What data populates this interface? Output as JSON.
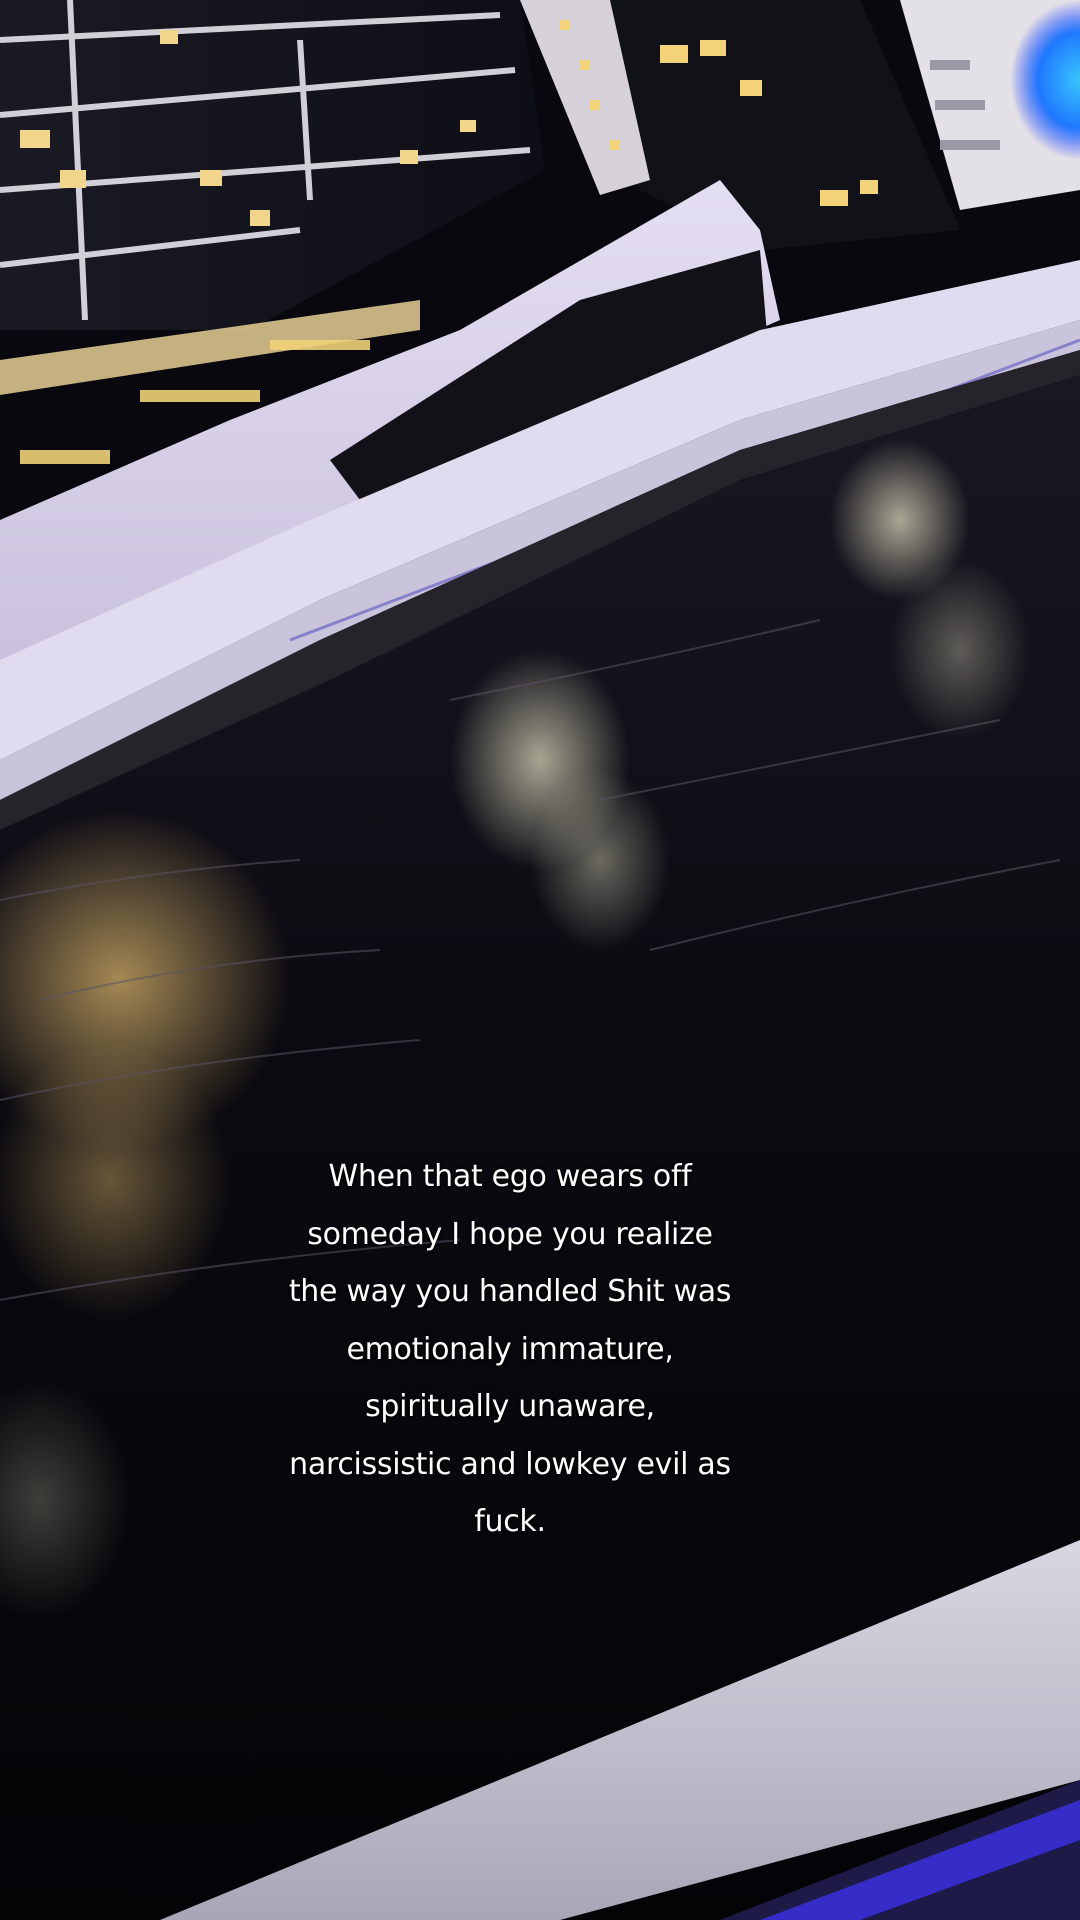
{
  "caption": {
    "lines": [
      "When that ego wears off",
      "someday I hope you realize",
      "the way you handled Shit was",
      "emotionaly immature,",
      "spiritually unaware,",
      "narcissistic and lowkey evil as",
      "fuck."
    ]
  },
  "colors": {
    "water": "#0a0a10",
    "building_white": "#dcd6ec",
    "accent_blue": "#2f7dff",
    "accent_purple": "#6a4bff",
    "window_light": "#f3d37a",
    "reflection": "#c9a25a"
  }
}
